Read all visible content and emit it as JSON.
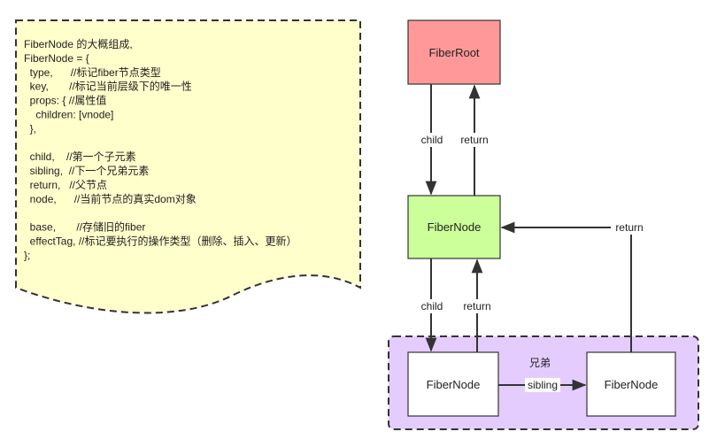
{
  "note": {
    "lines": [
      "FiberNode 的大概组成,",
      "FiberNode = {",
      "  type,      //标记fiber节点类型",
      "  key,       //标记当前层级下的唯一性",
      "  props: { //属性值",
      "    children: [vnode]",
      "  },",
      "",
      "  child,    //第一个子元素",
      "  sibling,  //下一个兄弟元素",
      "  return,   //父节点",
      "  node,      //当前节点的真实dom对象",
      "",
      "  base,       //存储旧的fiber",
      "  effectTag, //标记要执行的操作类型（删除、插入、更新）",
      "};"
    ],
    "fill": "#ffffcc"
  },
  "nodes": {
    "root": {
      "label": "FiberRoot",
      "fill": "#ff9999"
    },
    "fiber": {
      "label": "FiberNode",
      "fill": "#ccff99"
    },
    "child1": {
      "label": "FiberNode",
      "fill": "#ffffff"
    },
    "child2": {
      "label": "FiberNode",
      "fill": "#ffffff"
    }
  },
  "group": {
    "label": "兄弟",
    "fill": "#e5ccff"
  },
  "edges": {
    "root_child": "child",
    "root_return": "return",
    "fiber_child": "child",
    "fiber_return": "return",
    "sibling": "sibling",
    "sibling_return": "return"
  }
}
